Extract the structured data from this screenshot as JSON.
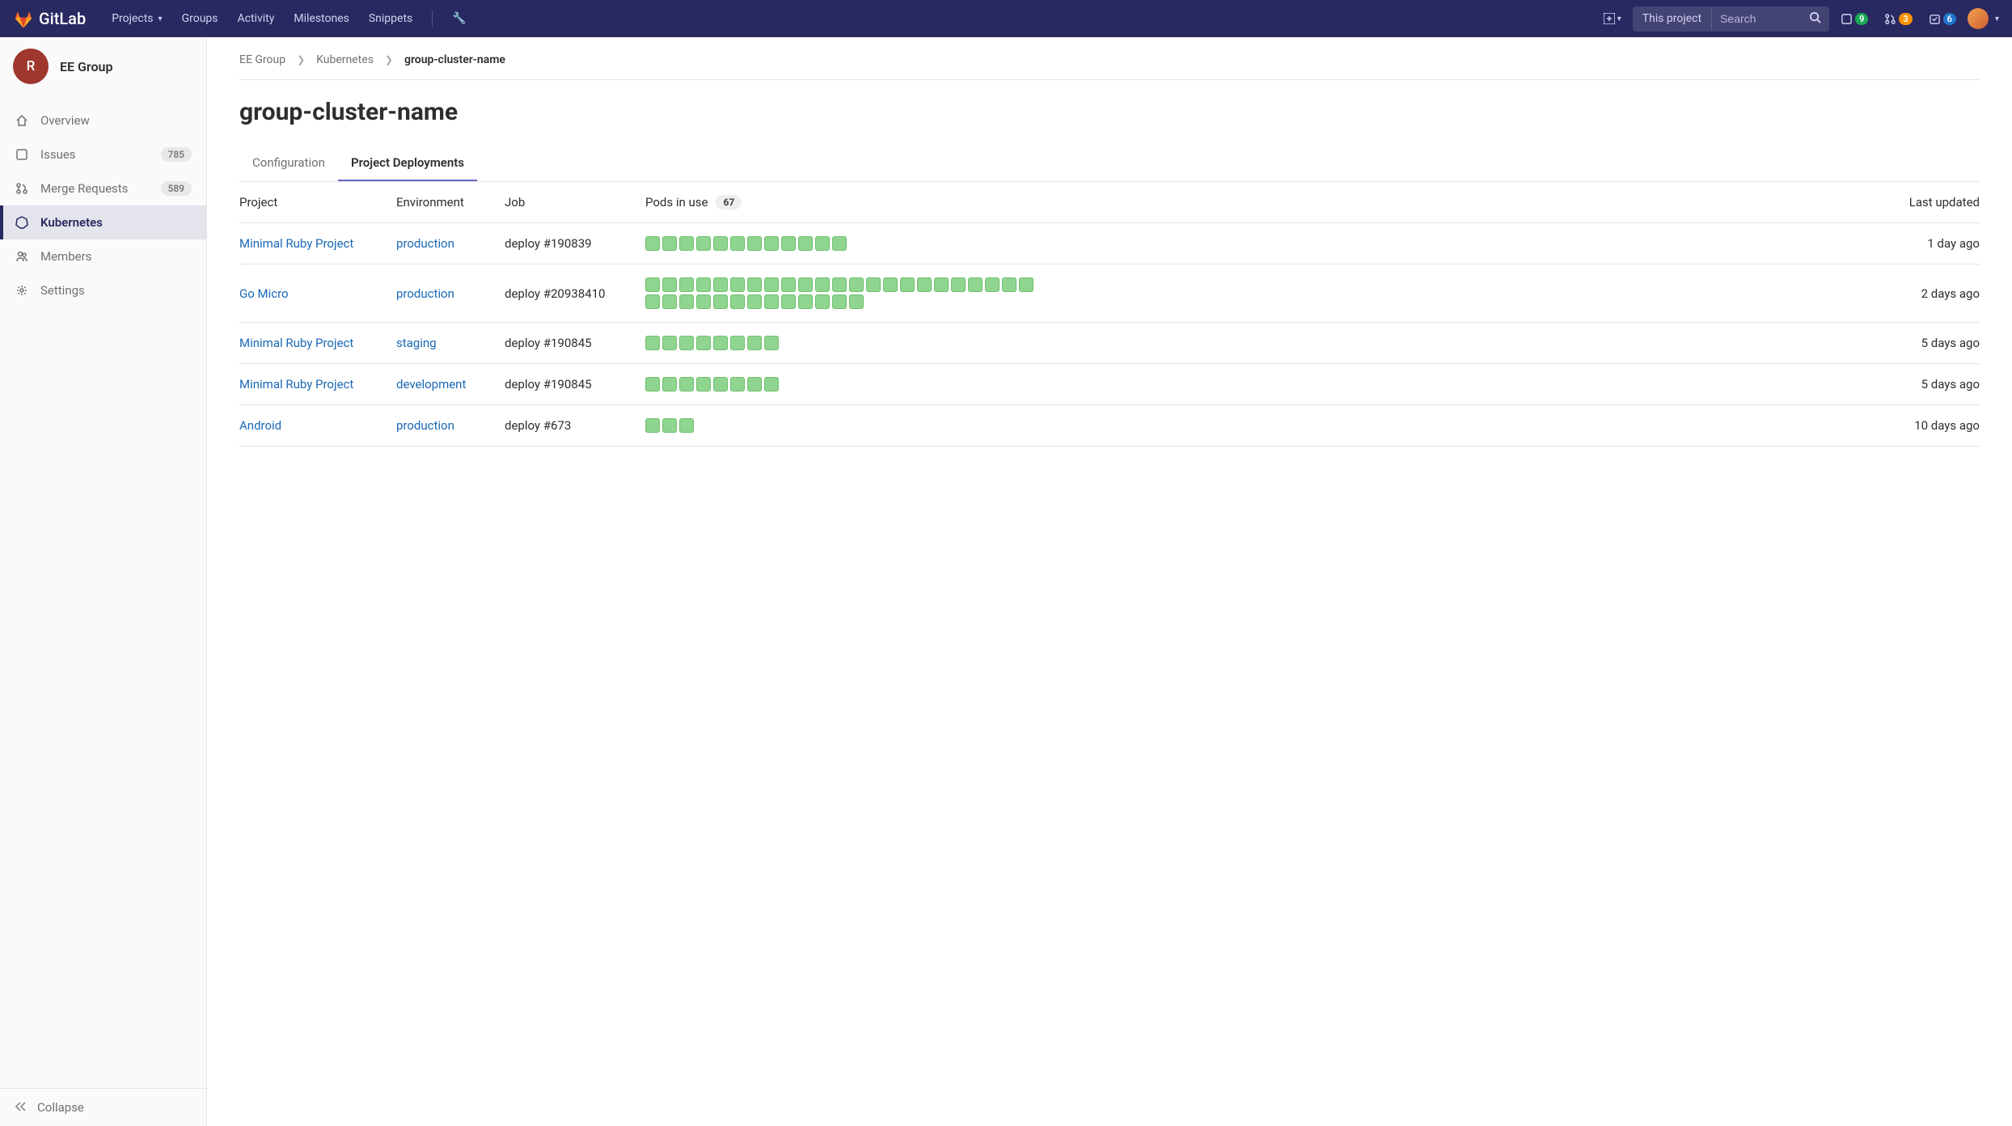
{
  "brand": "GitLab",
  "topnav": {
    "links": [
      "Projects",
      "Groups",
      "Activity",
      "Milestones",
      "Snippets"
    ],
    "search_scope": "This project",
    "search_placeholder": "Search",
    "badges": {
      "issues": "9",
      "mrs": "3",
      "todos": "6"
    }
  },
  "sidebar": {
    "avatar_letter": "R",
    "group_name": "EE Group",
    "items": [
      {
        "icon": "home-icon",
        "label": "Overview"
      },
      {
        "icon": "issues-icon",
        "label": "Issues",
        "count": "785"
      },
      {
        "icon": "mr-icon",
        "label": "Merge Requests",
        "count": "589"
      },
      {
        "icon": "kubernetes-icon",
        "label": "Kubernetes",
        "active": true
      },
      {
        "icon": "members-icon",
        "label": "Members"
      },
      {
        "icon": "settings-icon",
        "label": "Settings"
      }
    ],
    "collapse": "Collapse"
  },
  "breadcrumb": [
    "EE Group",
    "Kubernetes",
    "group-cluster-name"
  ],
  "page_title": "group-cluster-name",
  "tabs": [
    "Configuration",
    "Project Deployments"
  ],
  "active_tab": 1,
  "table": {
    "headers": {
      "project": "Project",
      "env": "Environment",
      "job": "Job",
      "pods": "Pods in use",
      "pods_total": "67",
      "updated": "Last updated"
    },
    "rows": [
      {
        "project": "Minimal Ruby Project",
        "env": "production",
        "job": "deploy #190839",
        "pods": 12,
        "updated": "1 day ago"
      },
      {
        "project": "Go Micro",
        "env": "production",
        "job": "deploy #20938410",
        "pods": 36,
        "updated": "2 days ago"
      },
      {
        "project": "Minimal Ruby Project",
        "env": "staging",
        "job": "deploy #190845",
        "pods": 8,
        "updated": "5 days ago"
      },
      {
        "project": "Minimal Ruby Project",
        "env": "development",
        "job": "deploy #190845",
        "pods": 8,
        "updated": "5 days ago"
      },
      {
        "project": "Android",
        "env": "production",
        "job": "deploy #673",
        "pods": 3,
        "updated": "10 days ago"
      }
    ]
  }
}
